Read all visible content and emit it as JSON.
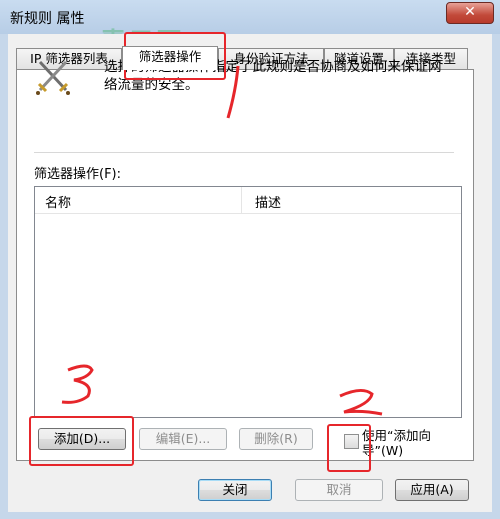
{
  "window": {
    "title": "新规则 属性",
    "close_glyph": "✕"
  },
  "tabs": [
    {
      "label": "IP 筛选器列表"
    },
    {
      "label": "筛选器操作"
    },
    {
      "label": "身份验证方法"
    },
    {
      "label": "隧道设置"
    },
    {
      "label": "连接类型"
    }
  ],
  "panel": {
    "description": "选择的筛选器操作指定了此规则是否协商及如何来保证网络流量的安全。",
    "list_label": "筛选器操作(F):",
    "columns": [
      "名称",
      "描述"
    ]
  },
  "buttons": {
    "add": "添加(D)...",
    "edit": "编辑(E)...",
    "remove": "删除(R)",
    "use_wizard": "使用“添加向导”(W)"
  },
  "footer": {
    "close": "关闭",
    "cancel": "取消",
    "apply": "应用(A)"
  },
  "annotations": {
    "labels": [
      "1",
      "2",
      "3"
    ],
    "color": "#e6262b"
  }
}
